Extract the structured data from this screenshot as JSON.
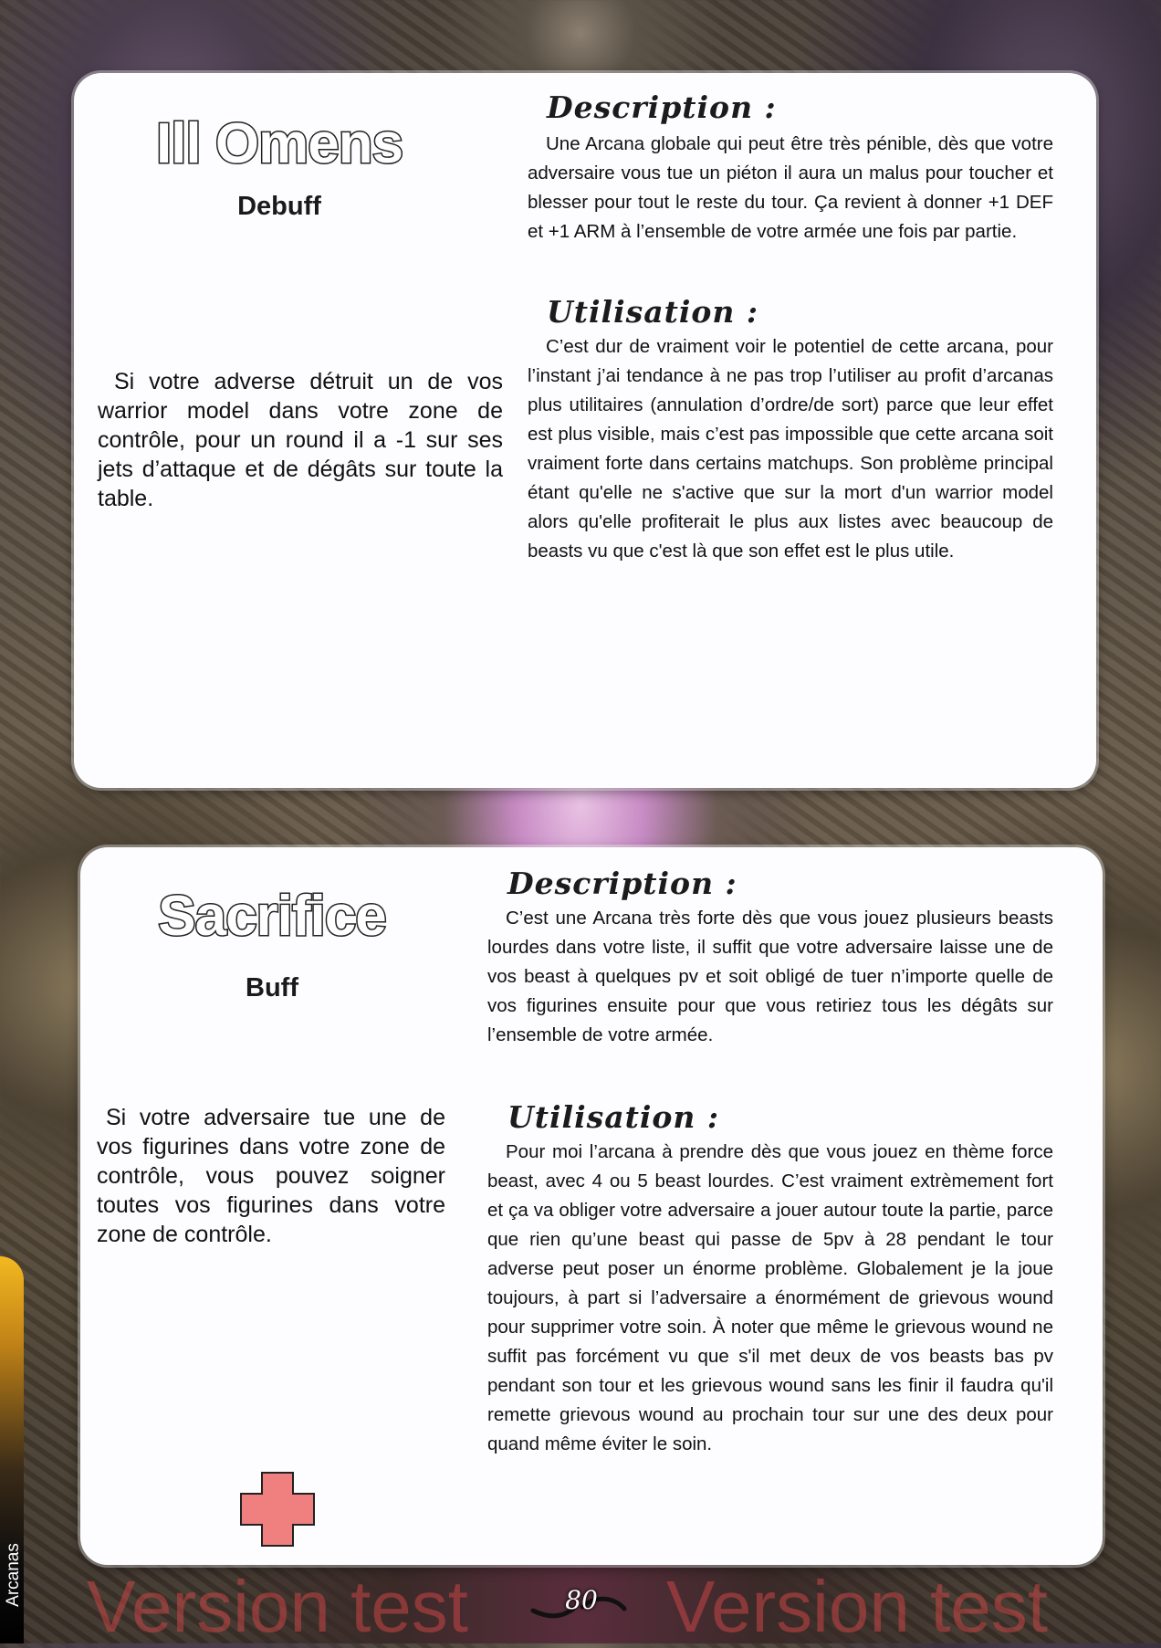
{
  "cards": [
    {
      "name": "Ill Omens",
      "type": "Debuff",
      "effect": "Si votre adverse détruit un de vos warrior model dans votre zone de contrôle, pour un round il a -1 sur ses jets d’attaque et de dégâts sur toute la table.",
      "description_heading": "Description :",
      "description": "Une Arcana globale qui peut être très pénible, dès que votre adversaire vous tue un piéton il aura un malus pour toucher et blesser pour tout le reste du tour. Ça revient à donner +1 DEF et +1 ARM à l’ensemble de votre armée une fois par partie.",
      "usage_heading": "Utilisation :",
      "usage": "C’est dur de vraiment voir le potentiel de cette arcana, pour l’instant j’ai tendance à ne pas trop l’utiliser au profit d’arcanas plus utilitaires (annulation d’ordre/de sort) parce que leur effet est plus visible, mais c’est pas impossible que cette arcana soit vraiment forte dans certains matchups. Son problème principal étant qu'elle ne s'active que sur la mort d'un warrior model alors qu'elle profiterait le plus aux listes avec beaucoup de beasts vu que c'est là que son effet est le plus utile."
    },
    {
      "name": "Sacrifice",
      "type": "Buff",
      "effect": "Si votre adversaire tue une de vos figurines dans votre zone de contrôle, vous pouvez soigner toutes vos figurines dans votre zone de contrôle.",
      "description_heading": "Description :",
      "description": "C’est une Arcana très forte dès que vous jouez plusieurs beasts lourdes dans votre liste, il suffit que votre adversaire laisse une de vos beast à quelques pv et soit obligé de tuer n’importe quelle de vos figurines ensuite pour que vous retiriez tous les dégâts sur l’ensemble de votre armée.",
      "usage_heading": "Utilisation :",
      "usage": "Pour moi l’arcana à prendre dès que vous jouez en thème force beast, avec 4 ou 5 beast lourdes. C’est vraiment extrèmement fort et ça va obliger votre adversaire a jouer autour toute la partie, parce que rien qu’une beast qui passe de 5pv à 28 pendant le tour adverse peut poser un énorme problème. Globalement je la joue toujours, à part si l’adversaire a énormément de grievous wound pour supprimer votre soin. À noter que même le grievous wound ne suffit pas forcément vu que s'il met deux de vos beasts bas pv pendant son tour et les grievous wound sans les finir il faudra qu'il remette grievous wound au prochain tour sur une des deux pour quand même éviter le soin.",
      "icon": "healing-cross-icon",
      "icon_color": "#f08080"
    }
  ],
  "side_tab": "Arcanas",
  "watermark": "Version test",
  "page_number": "80",
  "colors": {
    "panel": "#fdfcfe",
    "watermark": "#c84646",
    "tab_accent": "#f3b820"
  }
}
